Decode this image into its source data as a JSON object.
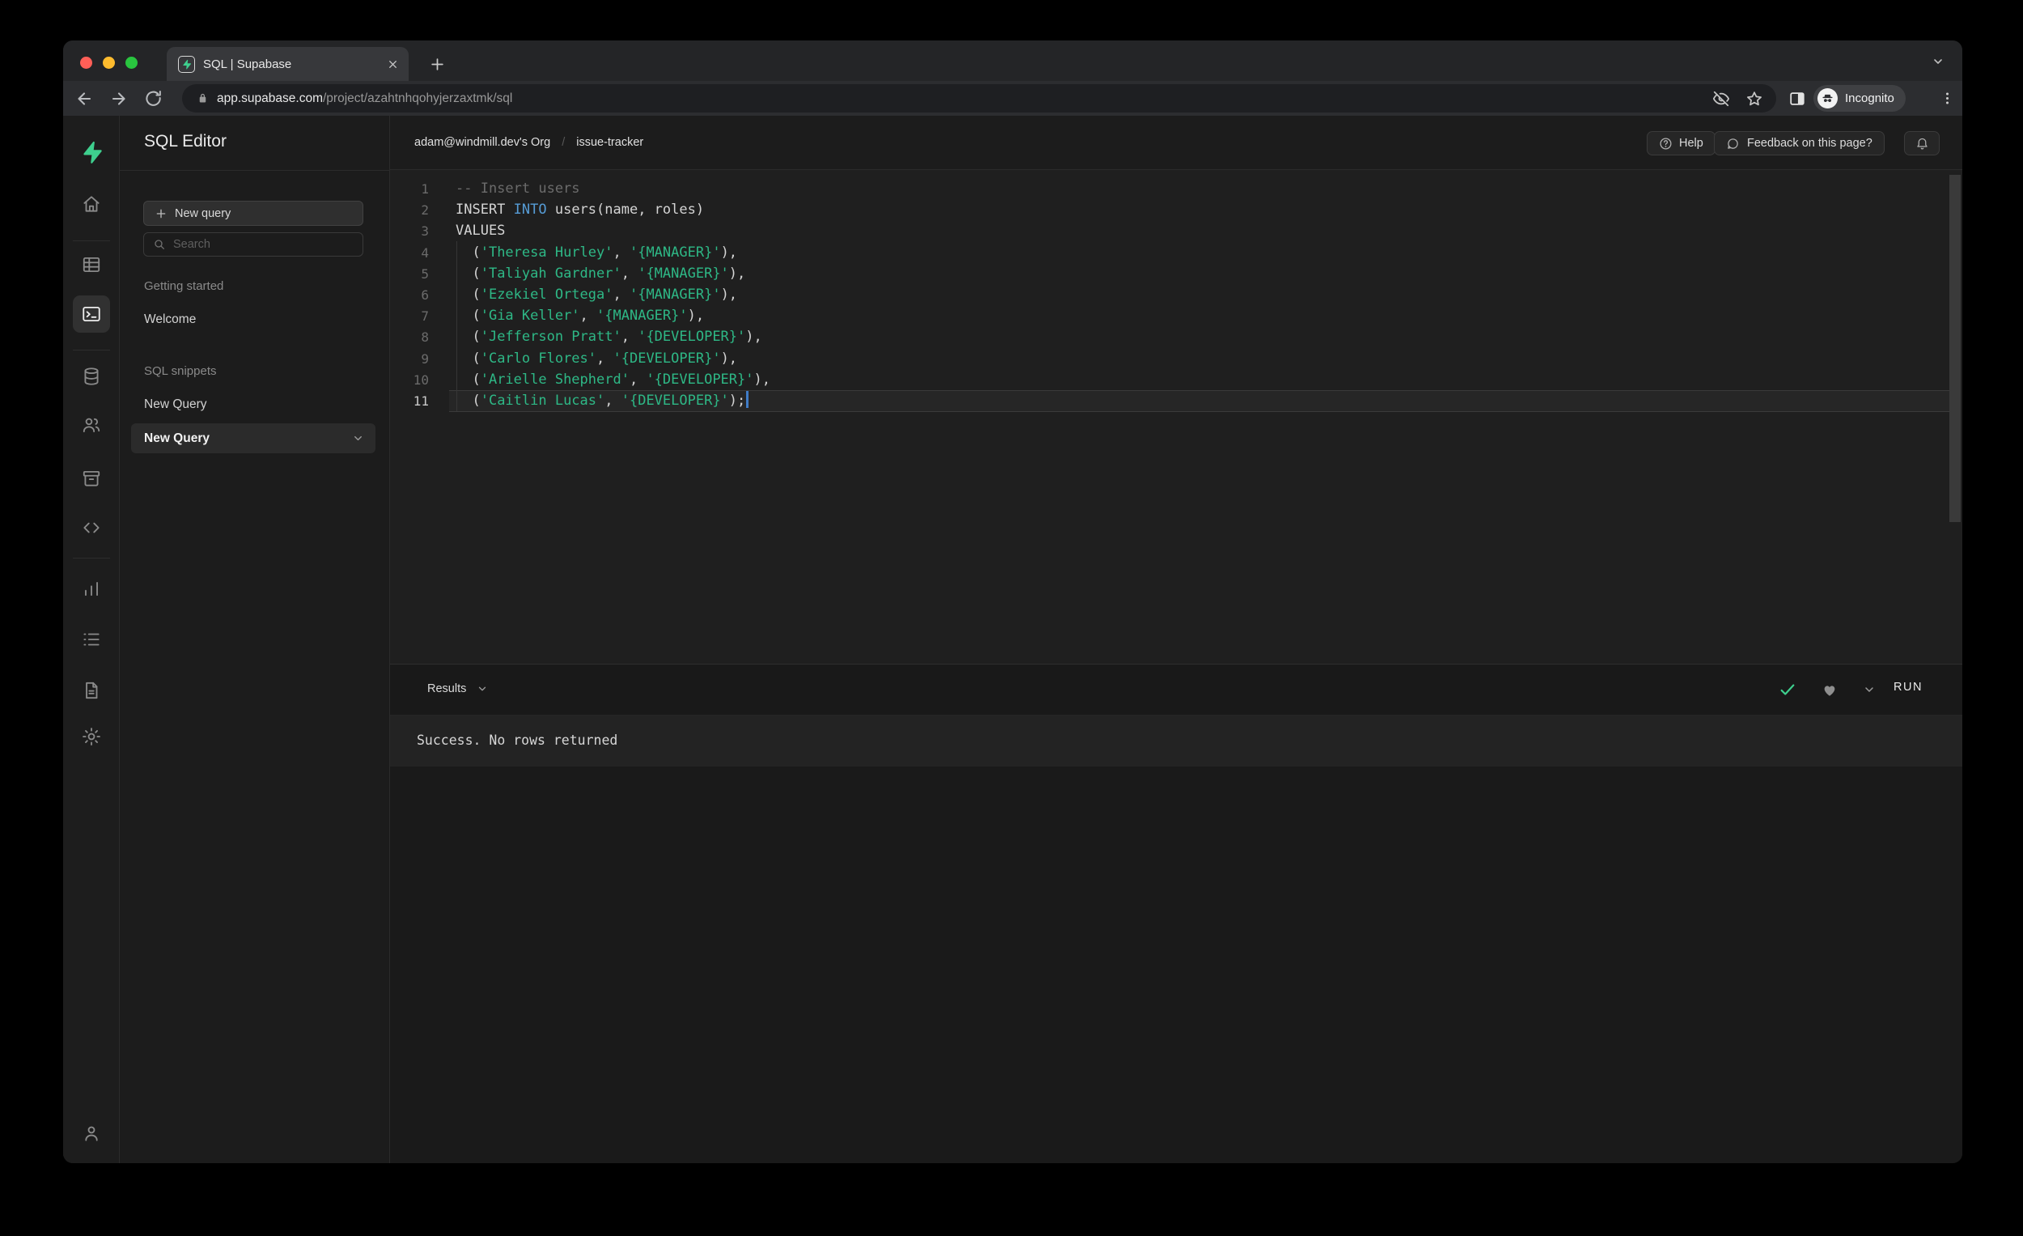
{
  "colors": {
    "brand_green": "#3ecf8e",
    "string_green": "#2eb886",
    "keyword_blue": "#569cd6",
    "traffic_red": "#ff5f57",
    "traffic_yellow": "#febc2e",
    "traffic_green": "#29c53f"
  },
  "browser": {
    "tab_title": "SQL | Supabase",
    "url_domain": "app.supabase.com",
    "url_path": "/project/azahtnhqohyjerzaxtmk/sql",
    "incognito_label": "Incognito"
  },
  "icon_rail": {
    "items": [
      {
        "kind": "logo",
        "name": "supabase-logo"
      },
      {
        "kind": "item",
        "name": "home"
      },
      {
        "kind": "divider"
      },
      {
        "kind": "item",
        "name": "table-editor"
      },
      {
        "kind": "item",
        "name": "sql-editor",
        "active": true
      },
      {
        "kind": "divider"
      },
      {
        "kind": "item",
        "name": "database"
      },
      {
        "kind": "item",
        "name": "auth-users"
      },
      {
        "kind": "item",
        "name": "storage"
      },
      {
        "kind": "item",
        "name": "edge-functions"
      },
      {
        "kind": "divider"
      },
      {
        "kind": "item",
        "name": "reports"
      },
      {
        "kind": "item",
        "name": "logs"
      },
      {
        "kind": "item",
        "name": "api-docs"
      },
      {
        "kind": "item",
        "name": "settings"
      },
      {
        "kind": "item",
        "name": "account"
      }
    ]
  },
  "sidebar": {
    "title": "SQL Editor",
    "new_query_button": "New query",
    "search_placeholder": "Search",
    "sections": [
      {
        "label": "Getting started",
        "items": [
          {
            "label": "Welcome"
          }
        ]
      },
      {
        "label": "SQL snippets",
        "items": [
          {
            "label": "New Query"
          },
          {
            "label": "New Query",
            "selected": true
          }
        ]
      }
    ]
  },
  "header": {
    "breadcrumb_org": "adam@windmill.dev's Org",
    "breadcrumb_separator": "/",
    "breadcrumb_project": "issue-tracker",
    "help_label": "Help",
    "feedback_label": "Feedback on this page?"
  },
  "editor": {
    "lines": [
      {
        "n": 1,
        "tokens": [
          {
            "t": "comment",
            "v": "-- Insert users"
          }
        ]
      },
      {
        "n": 2,
        "tokens": [
          {
            "t": "plain",
            "v": "INSERT "
          },
          {
            "t": "kw",
            "v": "INTO"
          },
          {
            "t": "plain",
            "v": " users(name, roles)"
          }
        ]
      },
      {
        "n": 3,
        "tokens": [
          {
            "t": "plain",
            "v": "VALUES"
          }
        ]
      },
      {
        "n": 4,
        "tokens": [
          {
            "t": "plain",
            "v": "  ("
          },
          {
            "t": "str",
            "v": "'Theresa Hurley'"
          },
          {
            "t": "plain",
            "v": ", "
          },
          {
            "t": "str",
            "v": "'{MANAGER}'"
          },
          {
            "t": "plain",
            "v": "),"
          }
        ]
      },
      {
        "n": 5,
        "tokens": [
          {
            "t": "plain",
            "v": "  ("
          },
          {
            "t": "str",
            "v": "'Taliyah Gardner'"
          },
          {
            "t": "plain",
            "v": ", "
          },
          {
            "t": "str",
            "v": "'{MANAGER}'"
          },
          {
            "t": "plain",
            "v": "),"
          }
        ]
      },
      {
        "n": 6,
        "tokens": [
          {
            "t": "plain",
            "v": "  ("
          },
          {
            "t": "str",
            "v": "'Ezekiel Ortega'"
          },
          {
            "t": "plain",
            "v": ", "
          },
          {
            "t": "str",
            "v": "'{MANAGER}'"
          },
          {
            "t": "plain",
            "v": "),"
          }
        ]
      },
      {
        "n": 7,
        "tokens": [
          {
            "t": "plain",
            "v": "  ("
          },
          {
            "t": "str",
            "v": "'Gia Keller'"
          },
          {
            "t": "plain",
            "v": ", "
          },
          {
            "t": "str",
            "v": "'{MANAGER}'"
          },
          {
            "t": "plain",
            "v": "),"
          }
        ]
      },
      {
        "n": 8,
        "tokens": [
          {
            "t": "plain",
            "v": "  ("
          },
          {
            "t": "str",
            "v": "'Jefferson Pratt'"
          },
          {
            "t": "plain",
            "v": ", "
          },
          {
            "t": "str",
            "v": "'{DEVELOPER}'"
          },
          {
            "t": "plain",
            "v": "),"
          }
        ]
      },
      {
        "n": 9,
        "tokens": [
          {
            "t": "plain",
            "v": "  ("
          },
          {
            "t": "str",
            "v": "'Carlo Flores'"
          },
          {
            "t": "plain",
            "v": ", "
          },
          {
            "t": "str",
            "v": "'{DEVELOPER}'"
          },
          {
            "t": "plain",
            "v": "),"
          }
        ]
      },
      {
        "n": 10,
        "tokens": [
          {
            "t": "plain",
            "v": "  ("
          },
          {
            "t": "str",
            "v": "'Arielle Shepherd'"
          },
          {
            "t": "plain",
            "v": ", "
          },
          {
            "t": "str",
            "v": "'{DEVELOPER}'"
          },
          {
            "t": "plain",
            "v": "),"
          }
        ]
      },
      {
        "n": 11,
        "tokens": [
          {
            "t": "plain",
            "v": "  ("
          },
          {
            "t": "str",
            "v": "'Caitlin Lucas'"
          },
          {
            "t": "plain",
            "v": ", "
          },
          {
            "t": "str",
            "v": "'{DEVELOPER}'"
          },
          {
            "t": "plain",
            "v": ");"
          }
        ],
        "active": true,
        "cursor": true
      }
    ]
  },
  "results": {
    "label": "Results",
    "run_label": "RUN",
    "message": "Success. No rows returned"
  }
}
